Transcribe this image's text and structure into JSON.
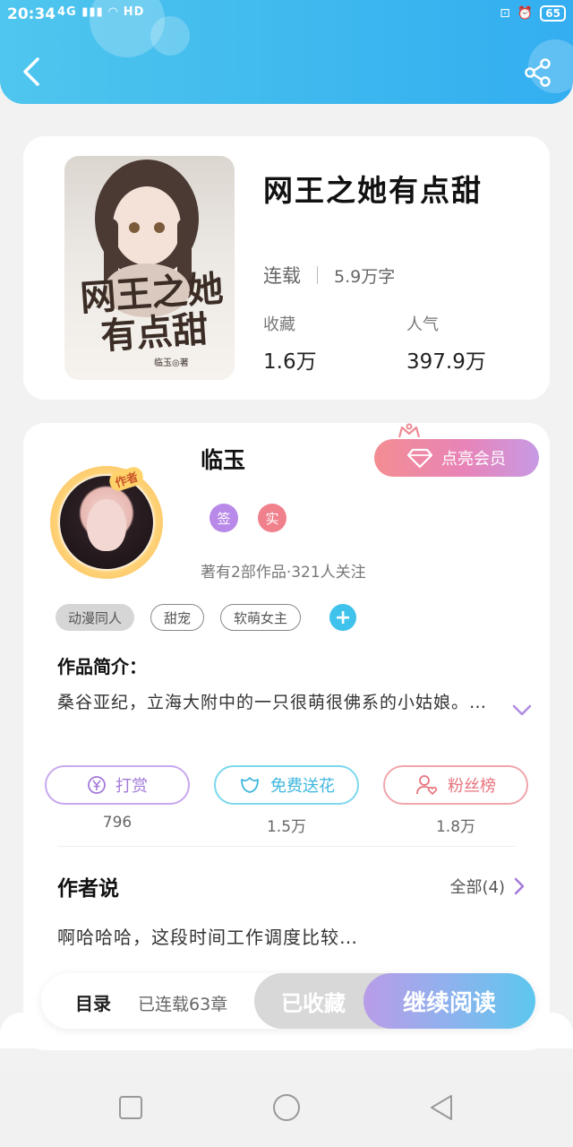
{
  "status_bar": {
    "time": "20:34",
    "signal": "4G",
    "network": "HD",
    "battery": "65"
  },
  "header": {
    "back_icon": "chevron-left-icon",
    "share_icon": "share-icon"
  },
  "book": {
    "cover_title": "网王之她有点甜",
    "cover_author": "临玉◎著",
    "title": "网王之她有点甜",
    "status": "连载",
    "word_count": "5.9万字",
    "favorites_label": "收藏",
    "favorites_value": "1.6万",
    "popularity_label": "人气",
    "popularity_value": "397.9万"
  },
  "author": {
    "avatar_badge": "作者",
    "name": "临玉",
    "vip_button": "点亮会员",
    "badge_sign": "签",
    "badge_real": "实",
    "meta": "著有2部作品·321人关注"
  },
  "tags": {
    "items": [
      "动漫同人",
      "甜宠",
      "软萌女主"
    ],
    "add_icon": "plus-icon"
  },
  "intro": {
    "label": "作品简介：",
    "text": "桑谷亚纪，立海大附中的一只很萌很佛系的小姑娘。…"
  },
  "actions": [
    {
      "label": "打赏",
      "count": "796",
      "icon": "yen-coin-icon"
    },
    {
      "label": "免费送花",
      "count": "1.5万",
      "icon": "flower-icon"
    },
    {
      "label": "粉丝榜",
      "count": "1.8万",
      "icon": "user-heart-icon"
    }
  ],
  "author_says": {
    "title": "作者说",
    "all_label": "全部(4)",
    "text": "啊哈哈哈，这段时间工作调度比较…"
  },
  "bottom_bar": {
    "toc": "目录",
    "chapters": "已连载63章",
    "favorited": "已收藏",
    "continue": "继续阅读"
  },
  "colors": {
    "header": "#3db7ee",
    "accent_cyan": "#3fc2ec",
    "accent_purple": "#b889e8",
    "accent_red": "#f0808c"
  }
}
